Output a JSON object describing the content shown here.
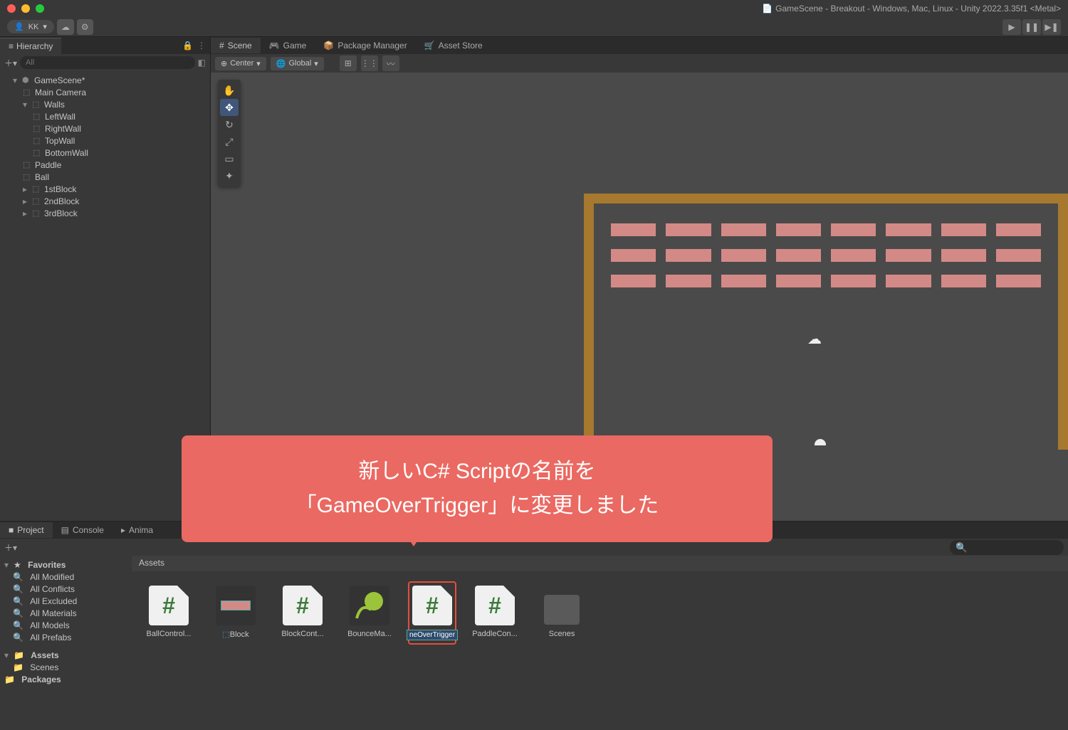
{
  "window": {
    "title": "GameScene - Breakout - Windows, Mac, Linux - Unity 2022.3.35f1 <Metal>"
  },
  "account": {
    "name": "KK"
  },
  "hierarchy": {
    "tab": "Hierarchy",
    "search_placeholder": "All",
    "scene": "GameScene*",
    "items": [
      "Main Camera",
      "Walls",
      "LeftWall",
      "RightWall",
      "TopWall",
      "BottomWall",
      "Paddle",
      "Ball",
      "1stBlock",
      "2ndBlock",
      "3rdBlock"
    ]
  },
  "scene_tabs": {
    "scene": "Scene",
    "game": "Game",
    "pkg": "Package Manager",
    "store": "Asset Store"
  },
  "scene_toolbar": {
    "pivot": "Center",
    "space": "Global"
  },
  "annotation": {
    "line1": "新しいC# Scriptの名前を",
    "line2": "「GameOverTrigger」に変更しました"
  },
  "project": {
    "tab_project": "Project",
    "tab_console": "Console",
    "tab_anim": "Anima",
    "breadcrumb": "Assets",
    "favorites": "Favorites",
    "fav_items": [
      "All Modified",
      "All Conflicts",
      "All Excluded",
      "All Materials",
      "All Models",
      "All Prefabs"
    ],
    "tree_assets": "Assets",
    "tree_scenes": "Scenes",
    "tree_packages": "Packages",
    "assets": [
      {
        "name": "BallControl...",
        "type": "script"
      },
      {
        "name": "Block",
        "type": "prefab"
      },
      {
        "name": "BlockCont...",
        "type": "script"
      },
      {
        "name": "BounceMa...",
        "type": "material"
      },
      {
        "name": "neOverTrigger",
        "type": "script",
        "editing": true
      },
      {
        "name": "PaddleCon...",
        "type": "script"
      },
      {
        "name": "Scenes",
        "type": "folder"
      }
    ]
  }
}
